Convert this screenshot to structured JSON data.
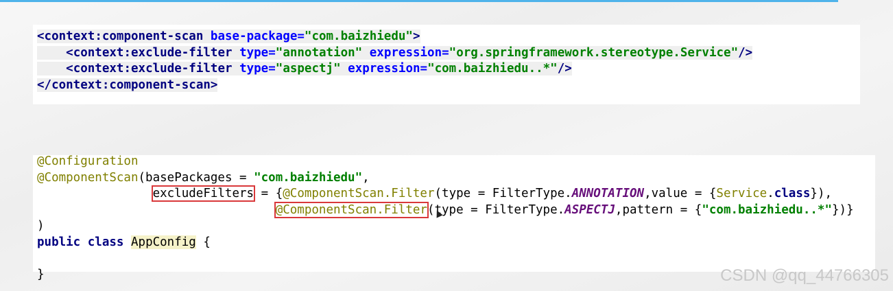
{
  "xml_snippet": {
    "lt": "<",
    "context_ns": "context",
    "colon": ":",
    "component_scan": "component-scan",
    "base_package_attr": "base-package",
    "eq": "=",
    "base_package_value": "\"com.baizhiedu\"",
    "gt": ">",
    "indent": "    ",
    "exclude_filter": "exclude-filter",
    "type_attr": "type",
    "expression_attr": "expression",
    "annotation_value": "\"annotation\"",
    "service_expression": "\"org.springframework.stereotype.Service\"",
    "aspectj_value": "\"aspectj\"",
    "package_expression": "\"com.baizhiedu..*\"",
    "self_close": "/>",
    "close_open": "</"
  },
  "java_snippet": {
    "configuration_annotation": "@Configuration",
    "component_scan_annotation": "@ComponentScan",
    "base_packages_part": "(basePackages = ",
    "base_packages_value": "\"com.baizhiedu\"",
    "comma": ",",
    "indent_line3": "                ",
    "exclude_filters": "excludeFilters",
    "exclude_filters_tail": " = {",
    "filter_annotation": "@ComponentScan.Filter",
    "type_part": "(type = FilterType.",
    "annotation_const": "ANNOTATION",
    "value_part": ",value = {",
    "service_class": "Service",
    "dot": ".",
    "class_kw": "class",
    "line3_end": "}),",
    "indent_line4": "                                 ",
    "aspectj_const": "ASPECTJ",
    "pattern_part": ",pattern = {",
    "pattern_value": "\"com.baizhiedu..*\"",
    "line4_end": "})}",
    "close_paren": ")",
    "public_kw": "public",
    "class_kw2": "class",
    "class_name": "AppConfig",
    "open_brace": " {",
    "close_brace": "}"
  },
  "watermark": "CSDN @qq_44766305",
  "colors": {
    "top_bar": "#4fb3ea",
    "xml_tag": "#000080",
    "xml_attr": "#0000ff",
    "string": "#008000",
    "annotation": "#808000",
    "keyword": "#000080",
    "enum_const": "#660e7a",
    "highlight_box": "#d9383a"
  }
}
